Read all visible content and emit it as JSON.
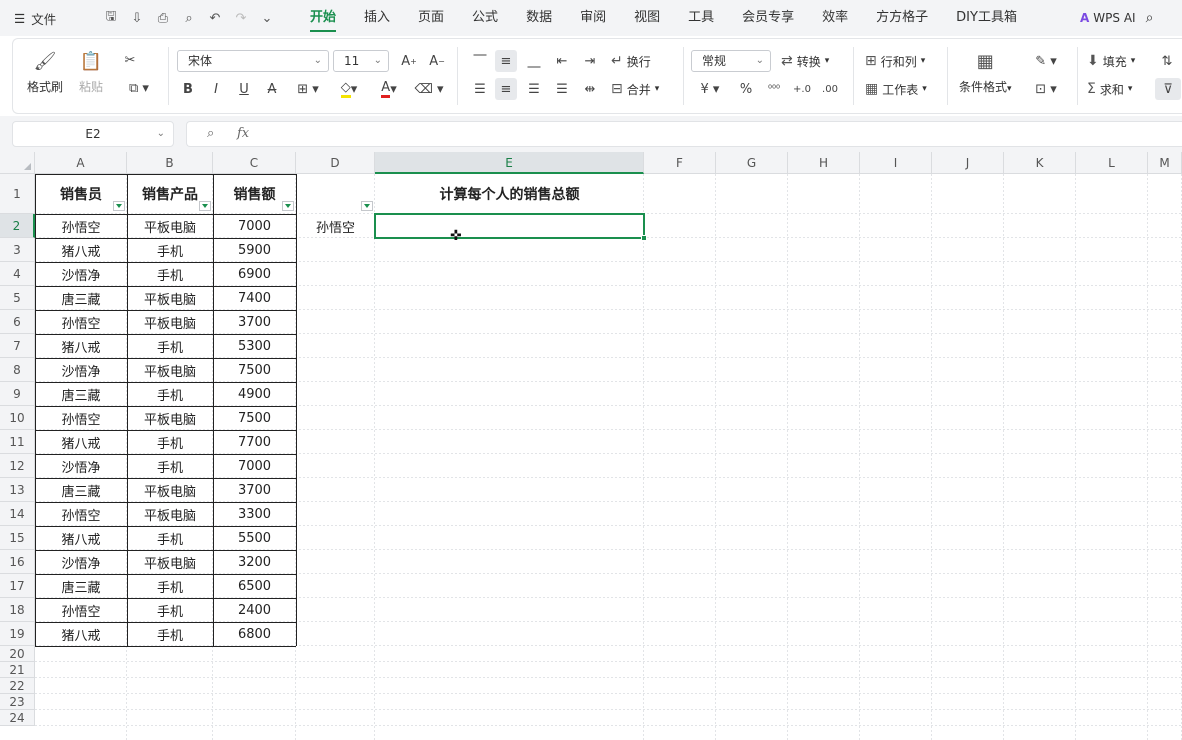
{
  "menubar": {
    "menu_label": "文件",
    "tabs": [
      "开始",
      "插入",
      "页面",
      "公式",
      "数据",
      "审阅",
      "视图",
      "工具",
      "会员专享",
      "效率",
      "方方格子",
      "DIY工具箱"
    ],
    "active_tab": "开始",
    "wps_ai": "WPS AI"
  },
  "ribbon": {
    "format_painter": "格式刷",
    "paste": "粘贴",
    "font_name": "宋体",
    "font_size": "11",
    "wrap": "换行",
    "merge": "合并",
    "number_format": "常规",
    "convert": "转换",
    "row_col": "行和列",
    "worksheet": "工作表",
    "cond_format": "条件格式",
    "fill": "填充",
    "sum": "求和"
  },
  "formula_bar": {
    "name_box": "E2",
    "fx": "fx",
    "content": ""
  },
  "sheet": {
    "columns": [
      "A",
      "B",
      "C",
      "D",
      "E",
      "F",
      "G",
      "H",
      "I",
      "J",
      "K",
      "L",
      "M"
    ],
    "rows": [
      "1",
      "2",
      "3",
      "4",
      "5",
      "6",
      "7",
      "8",
      "9",
      "10",
      "11",
      "12",
      "13",
      "14",
      "15",
      "16",
      "17",
      "18",
      "19",
      "20",
      "21",
      "22",
      "23",
      "24"
    ],
    "selected_cell": "E2",
    "headers": [
      "销售员",
      "销售产品",
      "销售额"
    ],
    "data": [
      [
        "孙悟空",
        "平板电脑",
        "7000"
      ],
      [
        "猪八戒",
        "手机",
        "5900"
      ],
      [
        "沙悟净",
        "手机",
        "6900"
      ],
      [
        "唐三藏",
        "平板电脑",
        "7400"
      ],
      [
        "孙悟空",
        "平板电脑",
        "3700"
      ],
      [
        "猪八戒",
        "手机",
        "5300"
      ],
      [
        "沙悟净",
        "平板电脑",
        "7500"
      ],
      [
        "唐三藏",
        "手机",
        "4900"
      ],
      [
        "孙悟空",
        "平板电脑",
        "7500"
      ],
      [
        "猪八戒",
        "手机",
        "7700"
      ],
      [
        "沙悟净",
        "手机",
        "7000"
      ],
      [
        "唐三藏",
        "平板电脑",
        "3700"
      ],
      [
        "孙悟空",
        "平板电脑",
        "3300"
      ],
      [
        "猪八戒",
        "手机",
        "5500"
      ],
      [
        "沙悟净",
        "平板电脑",
        "3200"
      ],
      [
        "唐三藏",
        "手机",
        "6500"
      ],
      [
        "孙悟空",
        "手机",
        "2400"
      ],
      [
        "猪八戒",
        "手机",
        "6800"
      ]
    ],
    "d2": "孙悟空",
    "e1": "计算每个人的销售总额"
  },
  "colors": {
    "accent": "#1a8f4e"
  }
}
